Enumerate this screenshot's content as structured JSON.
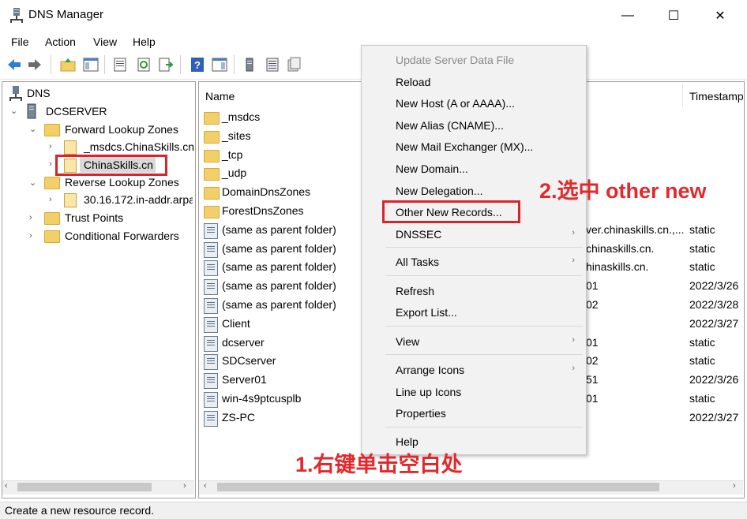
{
  "window": {
    "title": "DNS Manager",
    "minimize": "—",
    "maximize": "☐",
    "close": "✕"
  },
  "menubar": [
    "File",
    "Action",
    "View",
    "Help"
  ],
  "tree": {
    "root": "DNS",
    "server": "DCSERVER",
    "forward_zones": "Forward Lookup Zones",
    "zone_msdcs": "_msdcs.ChinaSkills.cn",
    "zone_selected": "ChinaSkills.cn",
    "reverse_zones": "Reverse Lookup Zones",
    "reverse_zone": "30.16.172.in-addr.arpa",
    "trust_points": "Trust Points",
    "conditional_forwarders": "Conditional Forwarders"
  },
  "list": {
    "col_name": "Name",
    "col_timestamp": "Timestamp",
    "rows": [
      {
        "name": "_msdcs",
        "data": "",
        "ts": ""
      },
      {
        "name": "_sites",
        "data": "",
        "ts": ""
      },
      {
        "name": "_tcp",
        "data": "",
        "ts": ""
      },
      {
        "name": "_udp",
        "data": "",
        "ts": ""
      },
      {
        "name": "DomainDnsZones",
        "data": "",
        "ts": ""
      },
      {
        "name": "ForestDnsZones",
        "data": "",
        "ts": ""
      },
      {
        "name": "(same as parent folder)",
        "data": "ver.chinaskills.cn.,...",
        "ts": "static"
      },
      {
        "name": "(same as parent folder)",
        "data": "chinaskills.cn.",
        "ts": "static"
      },
      {
        "name": "(same as parent folder)",
        "data": "hinaskills.cn.",
        "ts": "static"
      },
      {
        "name": "(same as parent folder)",
        "data": "01",
        "ts": "2022/3/26"
      },
      {
        "name": "(same as parent folder)",
        "data": "02",
        "ts": "2022/3/28"
      },
      {
        "name": "Client",
        "data": "",
        "ts": "2022/3/27"
      },
      {
        "name": "dcserver",
        "data": "01",
        "ts": "static"
      },
      {
        "name": "SDCserver",
        "data": "02",
        "ts": "static"
      },
      {
        "name": "Server01",
        "data": "51",
        "ts": "2022/3/26"
      },
      {
        "name": "win-4s9ptcusplb",
        "data": "01",
        "ts": "static"
      },
      {
        "name": "ZS-PC",
        "data": "",
        "ts": "2022/3/27"
      }
    ]
  },
  "context_menu": {
    "update_server": "Update Server Data File",
    "reload": "Reload",
    "new_host": "New Host (A or AAAA)...",
    "new_alias": "New Alias (CNAME)...",
    "new_mx": "New Mail Exchanger (MX)...",
    "new_domain": "New Domain...",
    "new_delegation": "New Delegation...",
    "other_new_records": "Other New Records...",
    "dnssec": "DNSSEC",
    "all_tasks": "All Tasks",
    "refresh": "Refresh",
    "export_list": "Export List...",
    "view": "View",
    "arrange_icons": "Arrange Icons",
    "line_up_icons": "Line up Icons",
    "properties": "Properties",
    "help": "Help"
  },
  "annotations": {
    "step1": "1.右键单击空白处",
    "step2": "2.选中 other new"
  },
  "status": "Create a new resource record.",
  "colors": {
    "highlight": "#d9242b",
    "annotation": "#e3282b"
  }
}
